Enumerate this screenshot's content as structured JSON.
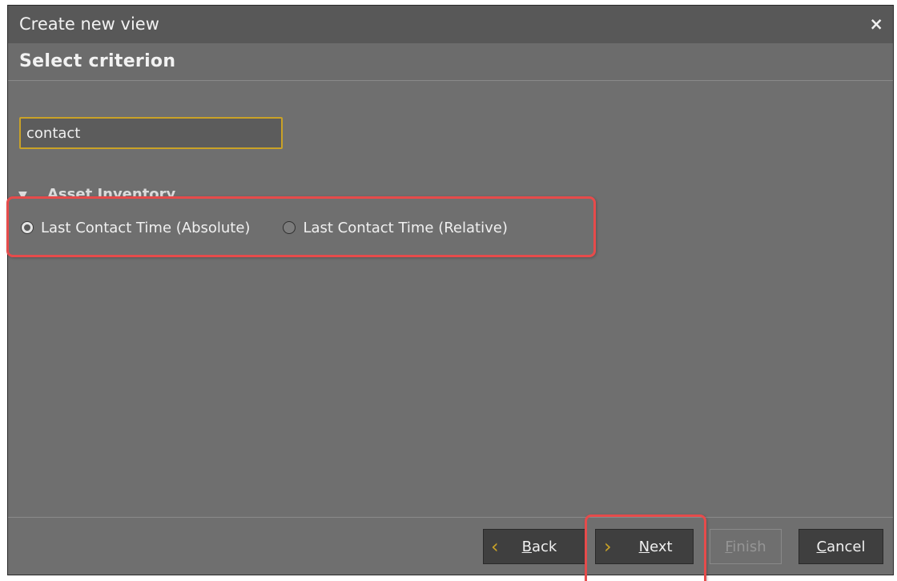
{
  "dialog": {
    "title": "Create new view",
    "close_glyph": "×",
    "subtitle": "Select criterion"
  },
  "search": {
    "value": "contact"
  },
  "group": {
    "toggle_glyph": "▼",
    "label": "Asset Inventory"
  },
  "options": [
    {
      "label": "Last Contact Time (Absolute)",
      "selected": true
    },
    {
      "label": "Last Contact Time (Relative)",
      "selected": false
    }
  ],
  "buttons": {
    "back": {
      "first": "B",
      "rest": "ack",
      "icon": "chevron-left-icon",
      "glyph": "‹"
    },
    "next": {
      "first": "N",
      "rest": "ext",
      "icon": "chevron-right-icon",
      "glyph": "›"
    },
    "finish": {
      "first": "F",
      "rest": "inish",
      "enabled": false
    },
    "cancel": {
      "first": "C",
      "rest": "ancel"
    }
  },
  "colors": {
    "dialog_bg": "#6f6f6f",
    "titlebar_bg": "#585858",
    "input_border": "#c9a227",
    "highlight": "#e64b4b",
    "button_bg": "#3f3f3f"
  }
}
